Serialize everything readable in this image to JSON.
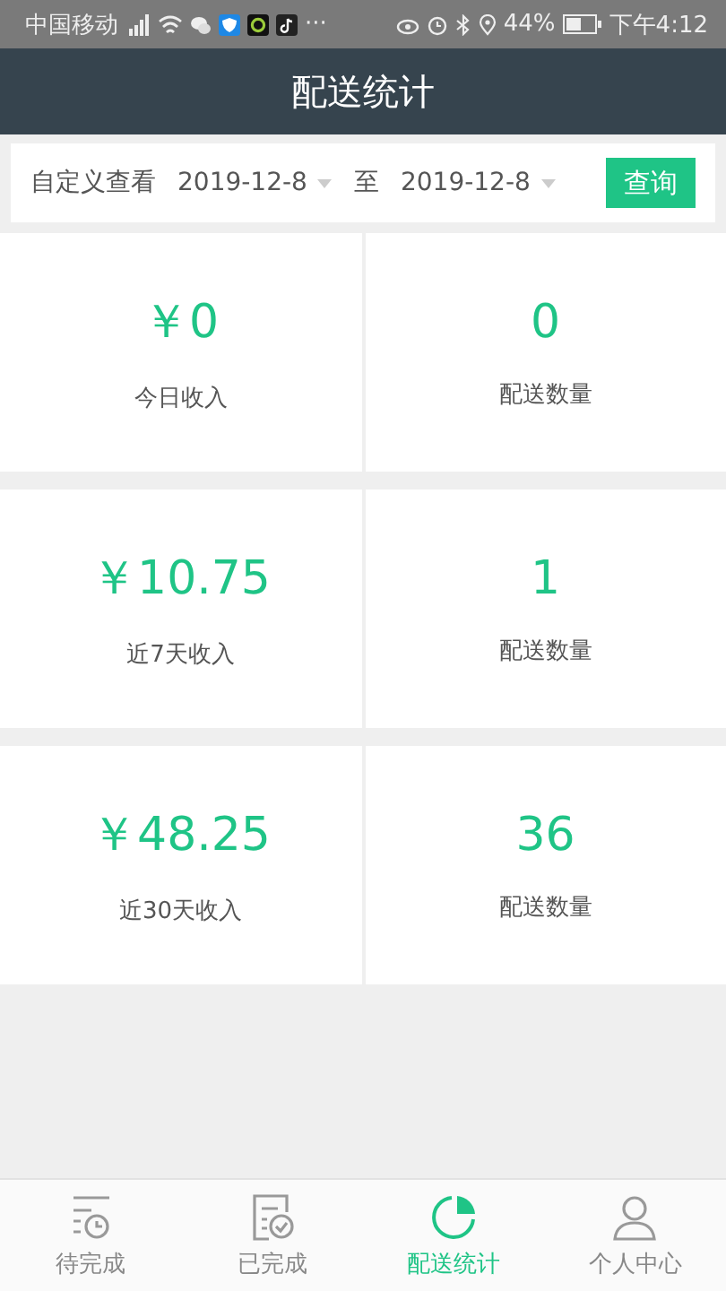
{
  "status_bar": {
    "carrier": "中国移动",
    "battery": "44%",
    "time": "下午4:12",
    "more": "···"
  },
  "header": {
    "title": "配送统计"
  },
  "filter": {
    "label": "自定义查看",
    "start_date": "2019-12-8",
    "separator": "至",
    "end_date": "2019-12-8",
    "button": "查询"
  },
  "stats": [
    {
      "income": "￥0",
      "income_label": "今日收入",
      "count": "0",
      "count_label": "配送数量"
    },
    {
      "income": "￥10.75",
      "income_label": "近7天收入",
      "count": "1",
      "count_label": "配送数量"
    },
    {
      "income": "￥48.25",
      "income_label": "近30天收入",
      "count": "36",
      "count_label": "配送数量"
    }
  ],
  "tabs": [
    {
      "label": "待完成",
      "kind": "pending",
      "selected": false
    },
    {
      "label": "已完成",
      "kind": "done",
      "selected": false
    },
    {
      "label": "配送统计",
      "kind": "stats",
      "selected": true
    },
    {
      "label": "个人中心",
      "kind": "profile",
      "selected": false
    }
  ]
}
